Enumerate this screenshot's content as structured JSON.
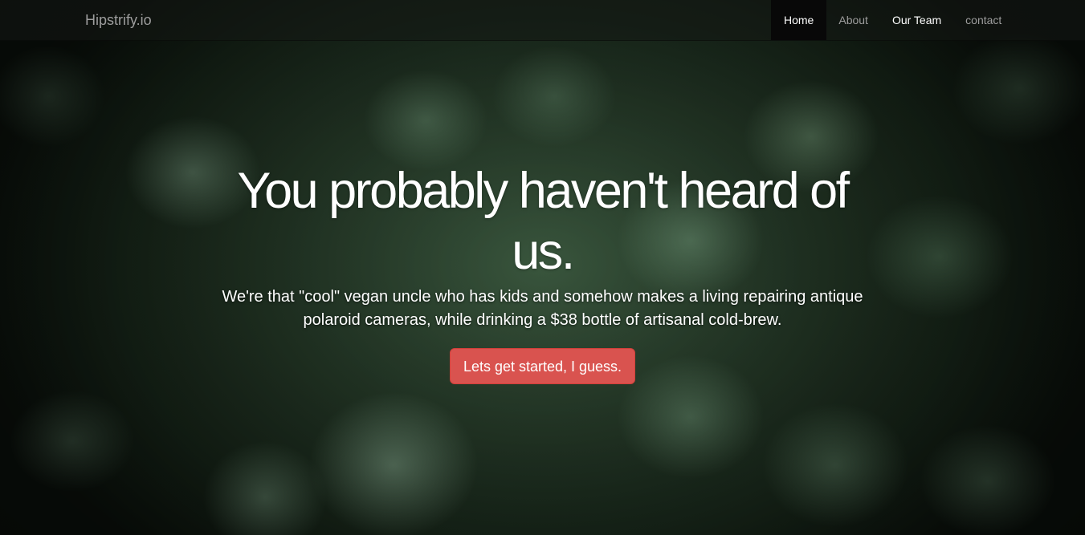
{
  "navbar": {
    "brand": "Hipstrify.io",
    "items": [
      {
        "label": "Home",
        "state": "active"
      },
      {
        "label": "About",
        "state": "default"
      },
      {
        "label": "Our Team",
        "state": "highlighted"
      },
      {
        "label": "contact",
        "state": "default"
      }
    ]
  },
  "hero": {
    "title": "You probably haven't heard of us.",
    "lead": "We're that \"cool\" vegan uncle who has kids and somehow makes a living repairing antique polaroid cameras, while drinking a $38 bottle of artisanal cold-brew.",
    "button_label": "Lets get started, I guess.",
    "button_color": "#d9534f"
  },
  "colors": {
    "navbar_text": "#9d9d9d",
    "navbar_active_bg": "#080808",
    "accent": "#d9534f"
  }
}
